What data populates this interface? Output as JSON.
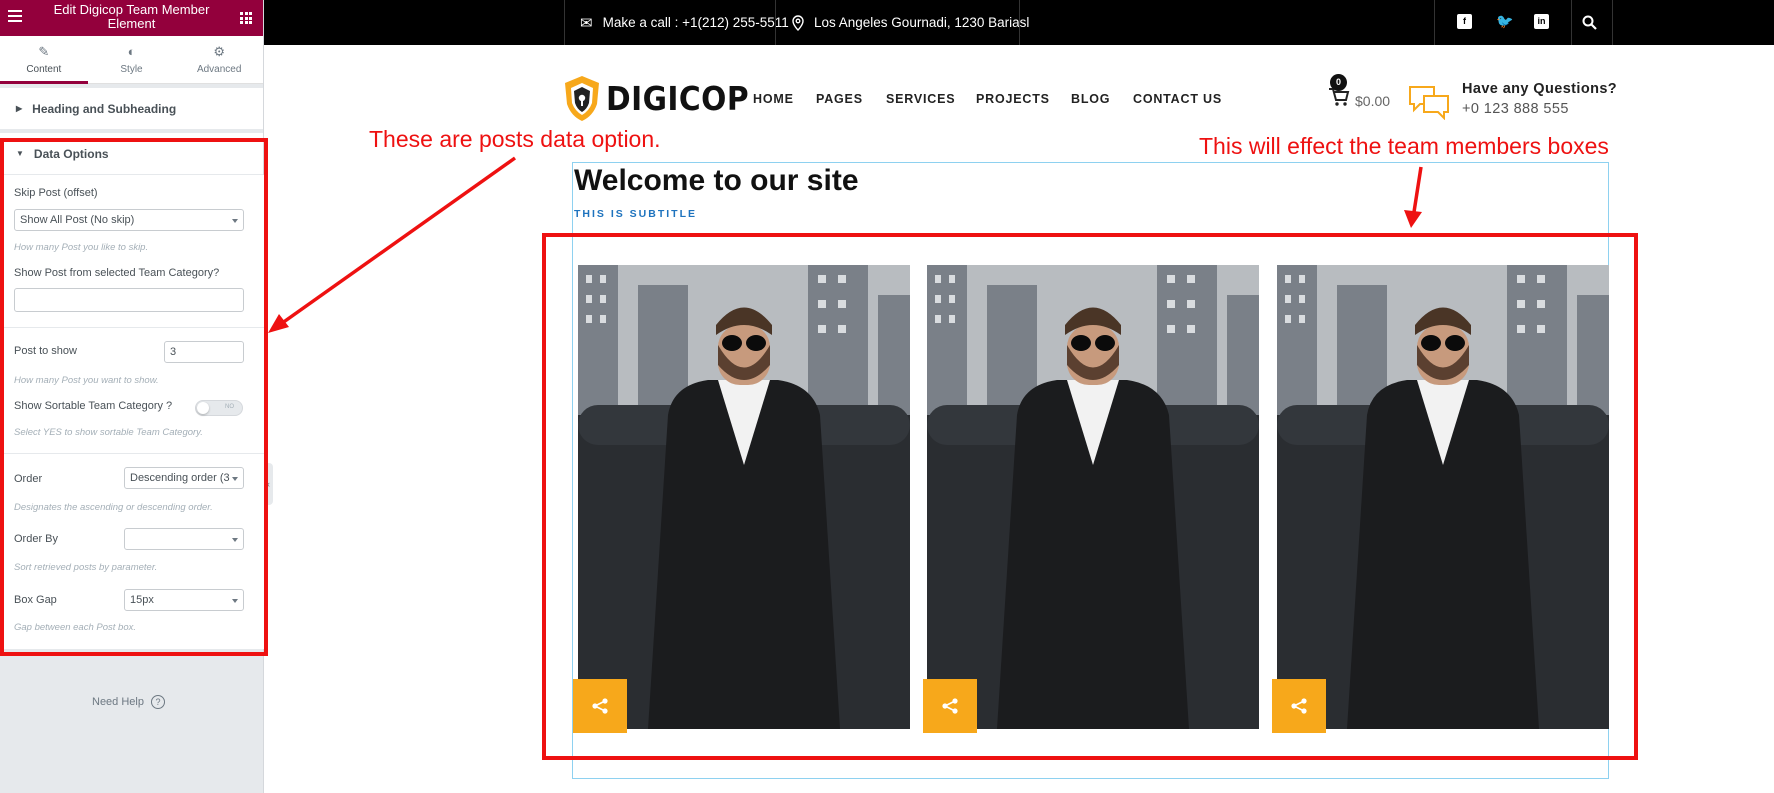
{
  "sidebar": {
    "title": "Edit Digicop Team Member Element",
    "tabs": [
      {
        "label": "Content",
        "icon": "pencil-icon"
      },
      {
        "label": "Style",
        "icon": "half-circle-icon"
      },
      {
        "label": "Advanced",
        "icon": "gear-icon"
      }
    ],
    "sections": {
      "heading": "Heading and Subheading",
      "data": "Data Options"
    },
    "fields": {
      "skip_post_label": "Skip Post (offset)",
      "skip_post_value": "Show All Post (No skip)",
      "skip_post_desc": "How many Post you like to skip.",
      "category_label": "Show Post from selected Team Category?",
      "category_value": "",
      "post_show_label": "Post to show",
      "post_show_value": "3",
      "post_show_desc": "How many Post you want to show.",
      "sortable_label": "Show Sortable Team Category ?",
      "sortable_toggle": "NO",
      "sortable_desc": "Select YES to show sortable Team Category.",
      "order_label": "Order",
      "order_value": "Descending order (3",
      "order_desc": "Designates the ascending or descending order.",
      "orderby_label": "Order By",
      "orderby_value": "",
      "orderby_desc": "Sort retrieved posts by parameter.",
      "boxgap_label": "Box Gap",
      "boxgap_value": "15px",
      "boxgap_desc": "Gap between each Post box."
    },
    "need_help": "Need Help"
  },
  "topbar": {
    "phone": "Make a call : +1(212) 255-5511",
    "address": "Los Angeles Gournadi, 1230 Bariasl",
    "social": [
      "facebook-icon",
      "twitter-icon",
      "linkedin-icon"
    ]
  },
  "nav": {
    "logo": "DIGICOP",
    "links": [
      "HOME",
      "PAGES",
      "SERVICES",
      "PROJECTS",
      "BLOG",
      "CONTACT US"
    ],
    "cart_count": "0",
    "cart_total": "$0.00",
    "question_title": "Have any Questions?",
    "question_phone": "+0 123 888 555"
  },
  "content": {
    "title": "Welcome to our site",
    "subtitle": "THIS IS SUBTITLE",
    "cards": 3
  },
  "annotations": {
    "left": "These are posts data option.",
    "right": "This will effect the team members boxes",
    "color": "#ee1111"
  },
  "colors": {
    "brand": "#93003c",
    "accent": "#f7a81b",
    "subtitle": "#1e73be"
  }
}
